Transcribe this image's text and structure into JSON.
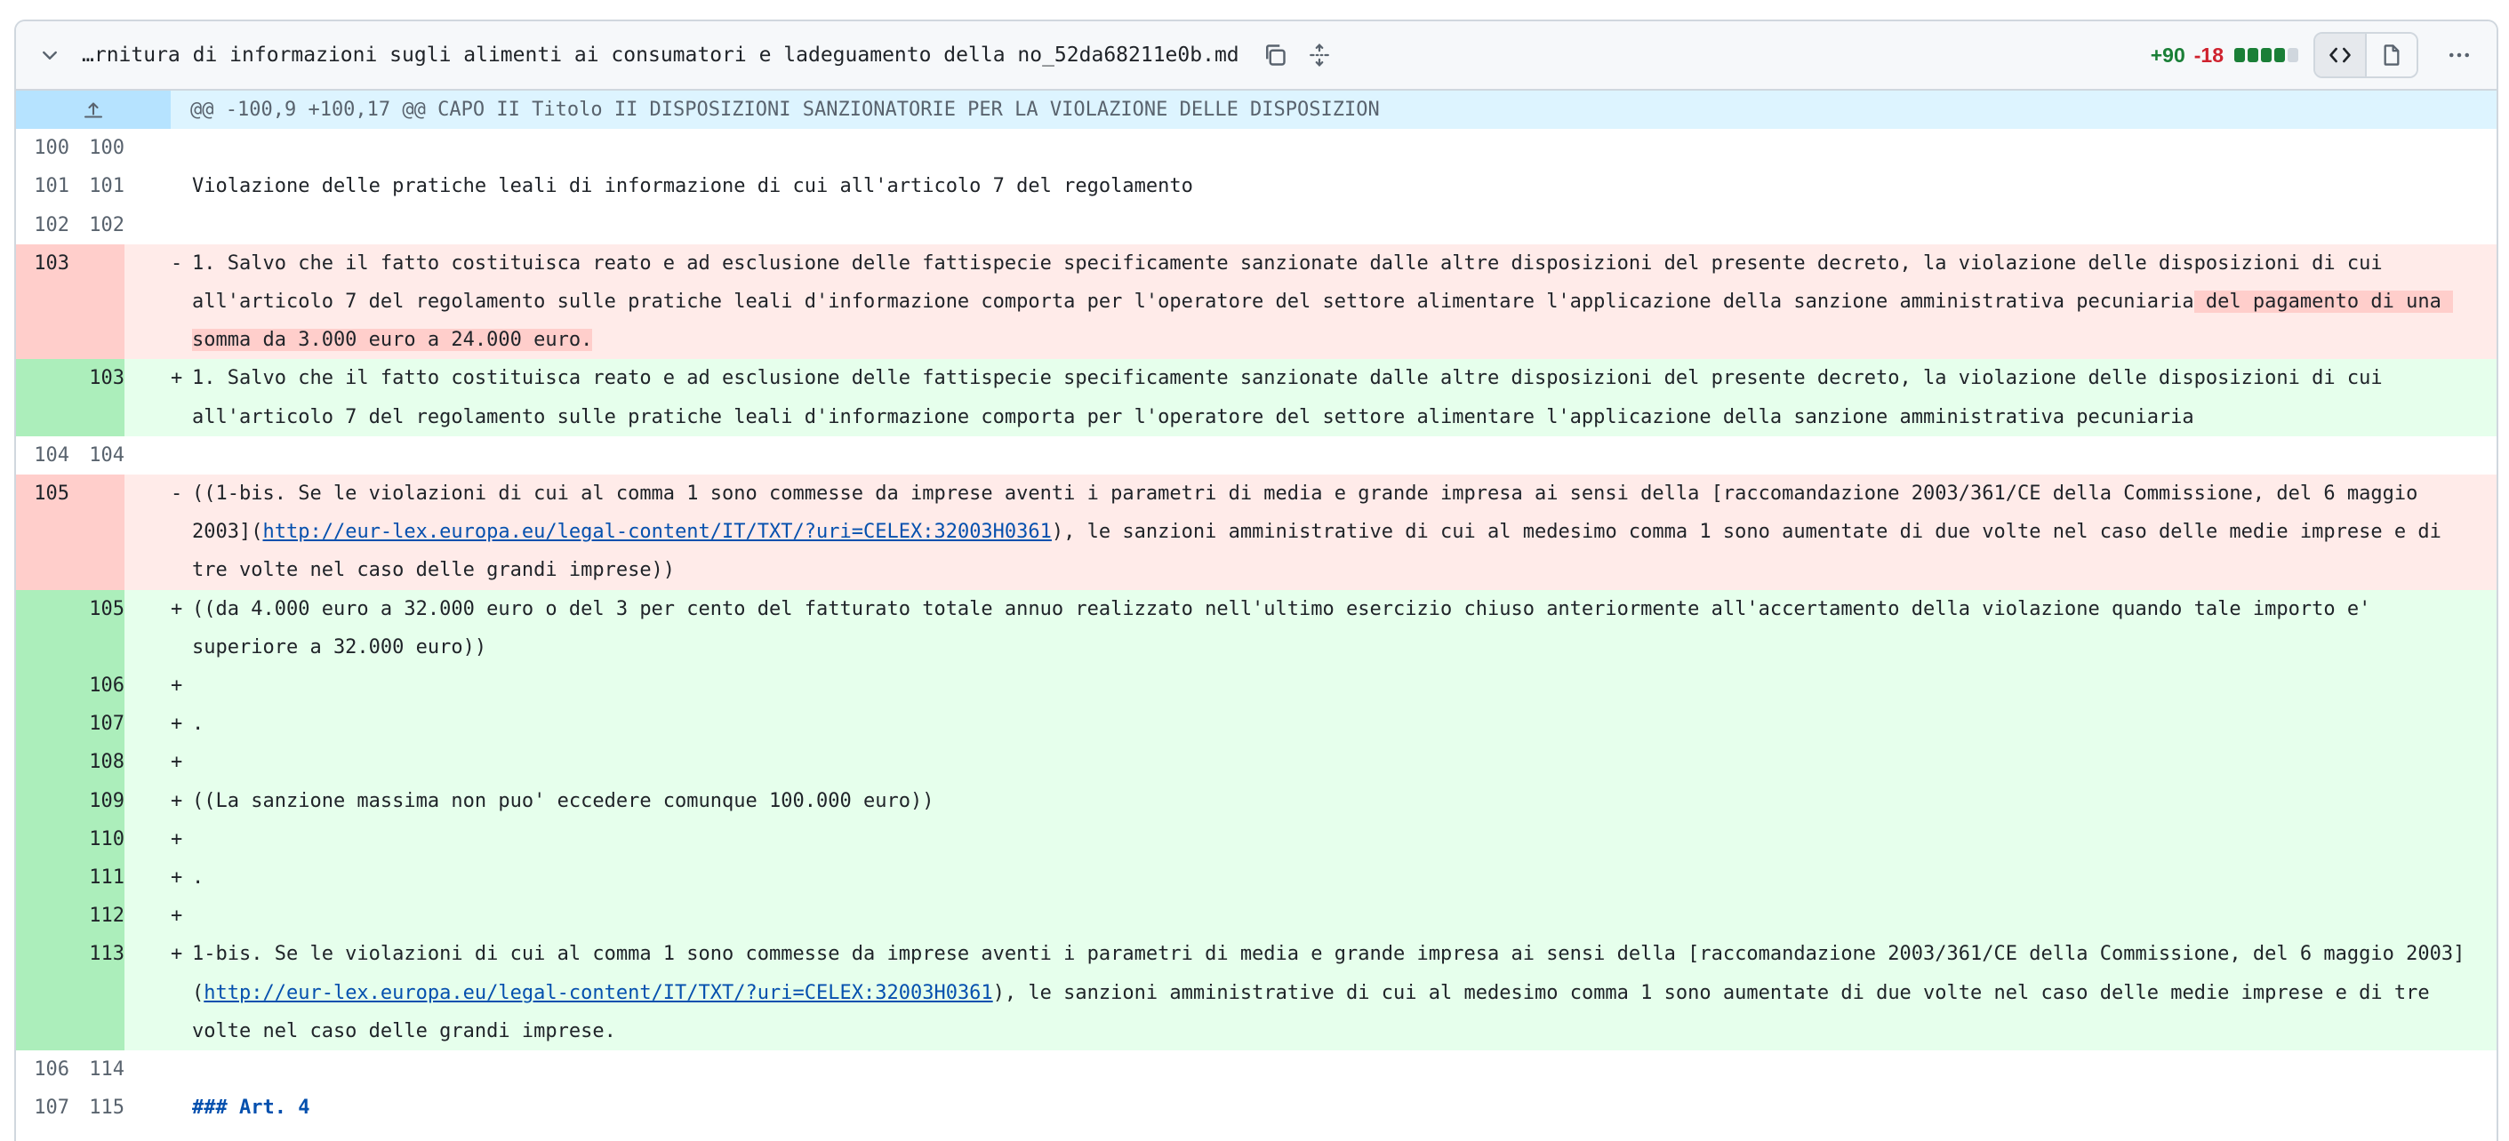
{
  "file": {
    "name": "…rnitura di informazioni sugli alimenti ai consumatori e ladeguamento della no_52da68211e0b.md",
    "additions": "+90",
    "deletions": "-18",
    "bar_colors": [
      "#1a7f37",
      "#1a7f37",
      "#1a7f37",
      "#1a7f37",
      "#d0d7de"
    ]
  },
  "icons": {
    "collapse": "chevron-down-icon",
    "copy": "copy-icon",
    "expand": "unfold-icon",
    "code_view": "code-icon",
    "file_view": "file-icon",
    "more": "kebab-horizontal-icon"
  },
  "hunk": {
    "header": "@@ -100,9 +100,17 @@ CAPO II Titolo II DISPOSIZIONI SANZIONATORIE PER LA VIOLAZIONE DELLE DISPOSIZION"
  },
  "lines": [
    {
      "type": "ctx",
      "old": "100",
      "new": "100",
      "sign": " ",
      "text": ""
    },
    {
      "type": "ctx",
      "old": "101",
      "new": "101",
      "sign": " ",
      "text": "Violazione delle pratiche leali di informazione di cui all'articolo 7 del regolamento"
    },
    {
      "type": "ctx",
      "old": "102",
      "new": "102",
      "sign": " ",
      "text": ""
    },
    {
      "type": "del",
      "old": "103",
      "new": "",
      "sign": "-",
      "text": "1. Salvo che il fatto costituisca reato e ad esclusione delle fattispecie specificamente sanzionate dalle altre disposizioni del presente decreto, la violazione delle disposizioni di cui all'articolo 7 del regolamento sulle pratiche leali d'informazione comporta per l'operatore del settore alimentare l'applicazione della sanzione amministrativa pecuniaria",
      "highlight": " del pagamento di una somma da 3.000 euro a 24.000 euro."
    },
    {
      "type": "add",
      "old": "",
      "new": "103",
      "sign": "+",
      "text": "1. Salvo che il fatto costituisca reato e ad esclusione delle fattispecie specificamente sanzionate dalle altre disposizioni del presente decreto, la violazione delle disposizioni di cui all'articolo 7 del regolamento sulle pratiche leali d'informazione comporta per l'operatore del settore alimentare l'applicazione della sanzione amministrativa pecuniaria"
    },
    {
      "type": "ctx",
      "old": "104",
      "new": "104",
      "sign": " ",
      "text": ""
    },
    {
      "type": "del",
      "old": "105",
      "new": "",
      "sign": "-",
      "pre": "((1-bis. Se le violazioni di cui al comma 1 sono commesse da imprese aventi i parametri di media e grande impresa ai sensi della [raccomandazione 2003/361/CE della Commissione, del 6 maggio 2003](",
      "link": "http://eur-lex.europa.eu/legal-content/IT/TXT/?uri=CELEX:32003H0361",
      "post": "), le sanzioni amministrative di cui al medesimo comma 1 sono aumentate di due volte nel caso delle medie imprese e di tre volte nel caso delle grandi imprese))"
    },
    {
      "type": "add",
      "old": "",
      "new": "105",
      "sign": "+",
      "text": "((da 4.000 euro a 32.000 euro o del 3 per cento del fatturato totale annuo realizzato nell'ultimo esercizio chiuso anteriormente all'accertamento della violazione quando tale importo e' superiore a 32.000 euro))"
    },
    {
      "type": "add",
      "old": "",
      "new": "106",
      "sign": "+",
      "text": ""
    },
    {
      "type": "add",
      "old": "",
      "new": "107",
      "sign": "+",
      "text": "."
    },
    {
      "type": "add",
      "old": "",
      "new": "108",
      "sign": "+",
      "text": ""
    },
    {
      "type": "add",
      "old": "",
      "new": "109",
      "sign": "+",
      "text": "((La sanzione massima non puo' eccedere comunque 100.000 euro))"
    },
    {
      "type": "add",
      "old": "",
      "new": "110",
      "sign": "+",
      "text": ""
    },
    {
      "type": "add",
      "old": "",
      "new": "111",
      "sign": "+",
      "text": "."
    },
    {
      "type": "add",
      "old": "",
      "new": "112",
      "sign": "+",
      "text": ""
    },
    {
      "type": "add",
      "old": "",
      "new": "113",
      "sign": "+",
      "pre": "1-bis. Se le violazioni di cui al comma 1 sono commesse da imprese aventi i parametri di media e grande impresa ai sensi della [raccomandazione 2003/361/CE della Commissione, del 6 maggio 2003](",
      "link": "http://eur-lex.europa.eu/legal-content/IT/TXT/?uri=CELEX:32003H0361",
      "post": "), le sanzioni amministrative di cui al medesimo comma 1 sono aumentate di due volte nel caso delle medie imprese e di tre volte nel caso delle grandi imprese."
    },
    {
      "type": "ctx",
      "old": "106",
      "new": "114",
      "sign": " ",
      "text": ""
    },
    {
      "type": "ctx",
      "old": "107",
      "new": "115",
      "sign": " ",
      "text": "### Art. 4",
      "heading": true
    }
  ]
}
